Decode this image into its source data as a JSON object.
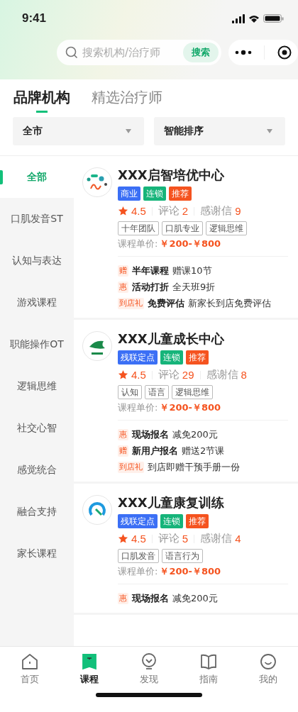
{
  "status_bar": {
    "time": "9:41"
  },
  "search": {
    "placeholder": "搜索机构/治疗师",
    "button": "搜索"
  },
  "tabs": [
    {
      "label": "品牌机构",
      "selected": true
    },
    {
      "label": "精选治疗师",
      "selected": false
    }
  ],
  "filters": [
    {
      "label": "全市"
    },
    {
      "label": "智能排序"
    }
  ],
  "sidebar": {
    "items": [
      {
        "label": "全部",
        "selected": true
      },
      {
        "label": "口肌发音ST",
        "selected": false
      },
      {
        "label": "认知与表达",
        "selected": false
      },
      {
        "label": "游戏课程",
        "selected": false
      },
      {
        "label": "职能操作OT",
        "selected": false
      },
      {
        "label": "逻辑思维",
        "selected": false
      },
      {
        "label": "社交心智",
        "selected": false
      },
      {
        "label": "感觉统合",
        "selected": false
      },
      {
        "label": "融合支持",
        "selected": false
      },
      {
        "label": "家长课程",
        "selected": false
      }
    ]
  },
  "institutions": [
    {
      "name": "XXX启智培优中心",
      "badges": [
        {
          "label": "商业",
          "color": "#3b6ff5"
        },
        {
          "label": "连锁",
          "color": "#16b47a"
        },
        {
          "label": "推荐",
          "color": "#f5531f"
        }
      ],
      "rating": "4.5",
      "reviews_label": "评论",
      "reviews": "2",
      "thanks_label": "感谢信",
      "thanks": "9",
      "tags": [
        "十年团队",
        "口肌专业",
        "逻辑思维"
      ],
      "price_label": "课程单价:",
      "price": "￥200-￥800",
      "offers": [
        {
          "badge": "赠",
          "title": "半年课程",
          "detail": "赠课10节"
        },
        {
          "badge": "惠",
          "title": "活动打折",
          "detail": "全天班9折"
        },
        {
          "badge": "到店礼",
          "title": "免费评估",
          "detail": "新家长到店免费评估"
        }
      ]
    },
    {
      "name": "XXX儿童成长中心",
      "badges": [
        {
          "label": "残联定点",
          "color": "#3b6ff5"
        },
        {
          "label": "连锁",
          "color": "#16b47a"
        },
        {
          "label": "推荐",
          "color": "#f5531f"
        }
      ],
      "rating": "4.5",
      "reviews_label": "评论",
      "reviews": "29",
      "thanks_label": "感谢信",
      "thanks": "8",
      "tags": [
        "认知",
        "语言",
        "逻辑思维"
      ],
      "price_label": "课程单价:",
      "price": "￥200-￥800",
      "offers": [
        {
          "badge": "惠",
          "title": "现场报名",
          "detail": "减免200元"
        },
        {
          "badge": "赠",
          "title": "新用户报名",
          "detail": "赠送2节课"
        },
        {
          "badge": "到店礼",
          "detail": "到店即赠干预手册一份"
        }
      ]
    },
    {
      "name": "XXX儿童康复训练",
      "badges": [
        {
          "label": "残联定点",
          "color": "#3b6ff5"
        },
        {
          "label": "连锁",
          "color": "#16b47a"
        },
        {
          "label": "推荐",
          "color": "#f5531f"
        }
      ],
      "rating": "4.5",
      "reviews_label": "评论",
      "reviews": "5",
      "thanks_label": "感谢信",
      "thanks": "4",
      "tags": [
        "口肌发音",
        "语言行为"
      ],
      "price_label": "课程单价:",
      "price": "￥200-￥800",
      "offers": [
        {
          "badge": "惠",
          "title": "现场报名",
          "detail": "减免200元"
        }
      ]
    }
  ],
  "bottom_nav": [
    {
      "label": "首页",
      "selected": false
    },
    {
      "label": "课程",
      "selected": true
    },
    {
      "label": "发现",
      "selected": false
    },
    {
      "label": "指南",
      "selected": false
    },
    {
      "label": "我的",
      "selected": false
    }
  ]
}
